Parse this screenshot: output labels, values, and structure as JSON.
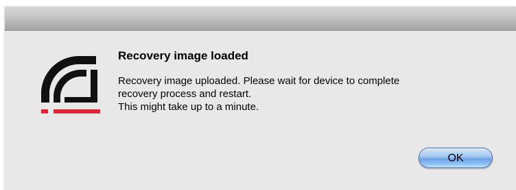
{
  "dialog": {
    "title": "Recovery image loaded",
    "message_lines": [
      "Recovery image uploaded.  Please wait for device to complete",
      "recovery process and restart.",
      "This might take up to a minute."
    ],
    "ok_label": "OK"
  },
  "icons": {
    "app_logo": "device-logo-icon"
  },
  "colors": {
    "logo_dark": "#111111",
    "logo_accent": "#e0243a",
    "button_blue": "#8dbdf0"
  }
}
